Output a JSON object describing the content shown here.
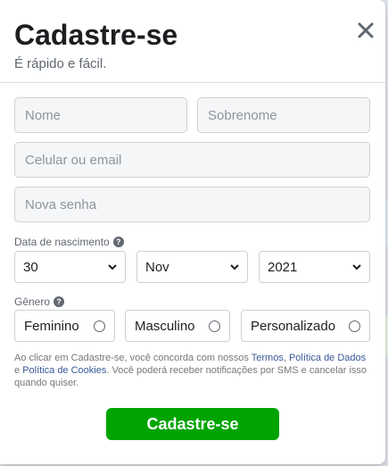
{
  "dialog": {
    "title": "Cadastre-se",
    "subtitle": "É rápido e fácil."
  },
  "fields": {
    "first_name_placeholder": "Nome",
    "last_name_placeholder": "Sobrenome",
    "contact_placeholder": "Celular ou email",
    "password_placeholder": "Nova senha"
  },
  "birthday": {
    "label": "Data de nascimento",
    "day": "30",
    "month": "Nov",
    "year": "2021"
  },
  "gender": {
    "label": "Gênero",
    "options": [
      "Feminino",
      "Masculino",
      "Personalizado"
    ]
  },
  "terms": {
    "text_1": "Ao clicar em Cadastre-se, você concorda com nossos ",
    "link_terms": "Termos",
    "text_2": ", ",
    "link_data_policy": "Política de Dados",
    "text_3": " e ",
    "link_cookie_policy": "Política de Cookies",
    "text_4": ". Você poderá receber notificações por SMS e cancelar isso quando quiser."
  },
  "submit_label": "Cadastre-se",
  "colors": {
    "primary_button": "#00a400",
    "link": "#385898"
  }
}
